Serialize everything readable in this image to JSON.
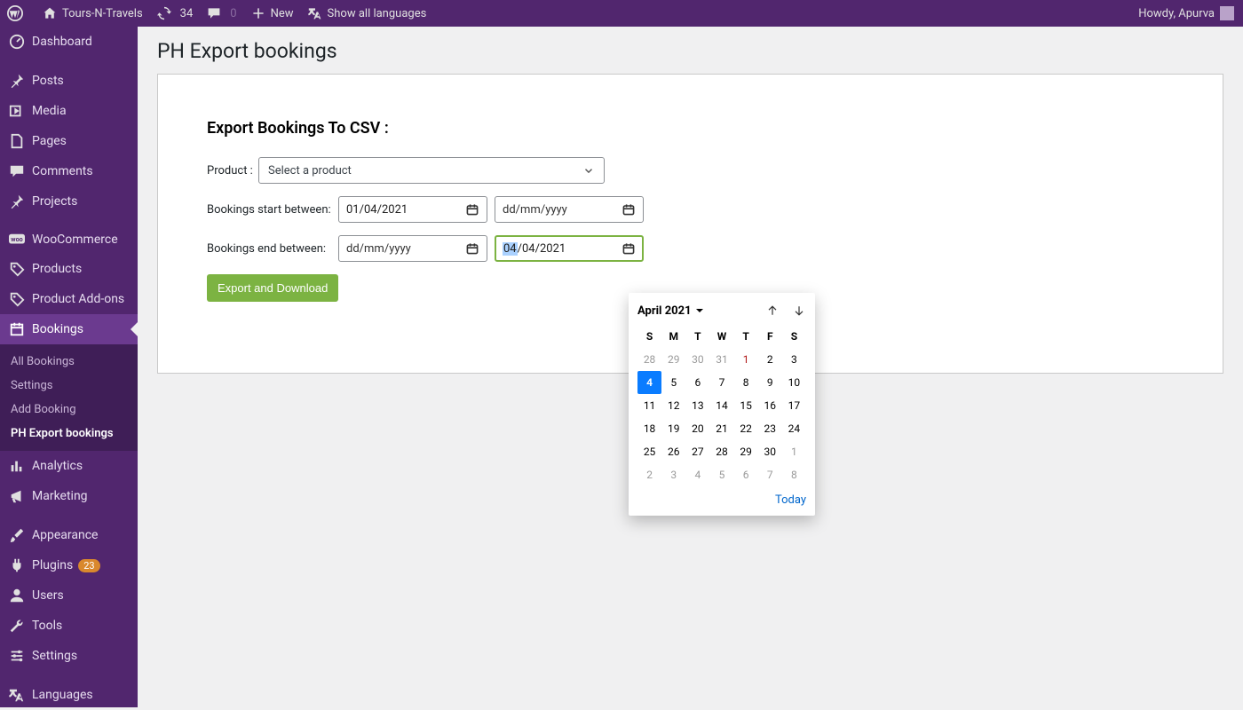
{
  "adminbar": {
    "site_name": "Tours-N-Travels",
    "updates_count": "34",
    "comments_count": "0",
    "new_label": "New",
    "languages_label": "Show all languages",
    "howdy": "Howdy, Apurva"
  },
  "sidebar": {
    "dashboard": "Dashboard",
    "posts": "Posts",
    "media": "Media",
    "pages": "Pages",
    "comments": "Comments",
    "projects": "Projects",
    "woocommerce": "WooCommerce",
    "products": "Products",
    "product_addons": "Product Add-ons",
    "bookings": "Bookings",
    "analytics": "Analytics",
    "marketing": "Marketing",
    "appearance": "Appearance",
    "plugins": "Plugins",
    "plugins_badge": "23",
    "users": "Users",
    "tools": "Tools",
    "settings": "Settings",
    "languages": "Languages"
  },
  "submenu": {
    "all_bookings": "All Bookings",
    "settings": "Settings",
    "add_booking": "Add Booking",
    "export": "PH Export bookings"
  },
  "page": {
    "title": "PH Export bookings",
    "section_heading": "Export Bookings To CSV :",
    "product_label": "Product :",
    "product_placeholder": "Select a product",
    "start_label": "Bookings start between:",
    "end_label": "Bookings end between:",
    "date_placeholder": "dd/mm/yyyy",
    "start_from_value": "01/04/2021",
    "end_to_selected_segment": "04",
    "end_to_rest": "/04/2021",
    "export_btn": "Export and Download"
  },
  "datepicker": {
    "month_label": "April 2021",
    "dow": [
      "S",
      "M",
      "T",
      "W",
      "T",
      "F",
      "S"
    ],
    "weeks": [
      [
        {
          "d": "28",
          "cls": "other"
        },
        {
          "d": "29",
          "cls": "other"
        },
        {
          "d": "30",
          "cls": "other"
        },
        {
          "d": "31",
          "cls": "other"
        },
        {
          "d": "1",
          "cls": "red"
        },
        {
          "d": "2",
          "cls": ""
        },
        {
          "d": "3",
          "cls": ""
        }
      ],
      [
        {
          "d": "4",
          "cls": "selected"
        },
        {
          "d": "5",
          "cls": ""
        },
        {
          "d": "6",
          "cls": ""
        },
        {
          "d": "7",
          "cls": ""
        },
        {
          "d": "8",
          "cls": ""
        },
        {
          "d": "9",
          "cls": ""
        },
        {
          "d": "10",
          "cls": ""
        }
      ],
      [
        {
          "d": "11",
          "cls": ""
        },
        {
          "d": "12",
          "cls": ""
        },
        {
          "d": "13",
          "cls": ""
        },
        {
          "d": "14",
          "cls": ""
        },
        {
          "d": "15",
          "cls": ""
        },
        {
          "d": "16",
          "cls": ""
        },
        {
          "d": "17",
          "cls": ""
        }
      ],
      [
        {
          "d": "18",
          "cls": ""
        },
        {
          "d": "19",
          "cls": ""
        },
        {
          "d": "20",
          "cls": ""
        },
        {
          "d": "21",
          "cls": ""
        },
        {
          "d": "22",
          "cls": ""
        },
        {
          "d": "23",
          "cls": ""
        },
        {
          "d": "24",
          "cls": ""
        }
      ],
      [
        {
          "d": "25",
          "cls": ""
        },
        {
          "d": "26",
          "cls": ""
        },
        {
          "d": "27",
          "cls": ""
        },
        {
          "d": "28",
          "cls": ""
        },
        {
          "d": "29",
          "cls": ""
        },
        {
          "d": "30",
          "cls": ""
        },
        {
          "d": "1",
          "cls": "other"
        }
      ],
      [
        {
          "d": "2",
          "cls": "other"
        },
        {
          "d": "3",
          "cls": "other"
        },
        {
          "d": "4",
          "cls": "other"
        },
        {
          "d": "5",
          "cls": "other"
        },
        {
          "d": "6",
          "cls": "other"
        },
        {
          "d": "7",
          "cls": "other"
        },
        {
          "d": "8",
          "cls": "other"
        }
      ]
    ],
    "today_label": "Today"
  }
}
